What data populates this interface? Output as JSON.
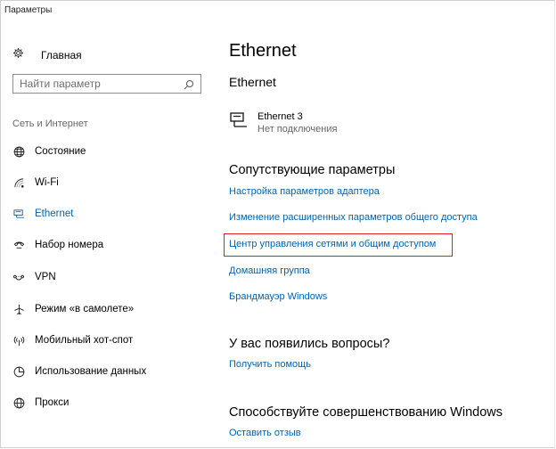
{
  "window": {
    "title": "Параметры"
  },
  "sidebar": {
    "home_label": "Главная",
    "search_placeholder": "Найти параметр",
    "section_title": "Сеть и Интернет",
    "items": [
      {
        "label": "Состояние",
        "icon": "globe-icon"
      },
      {
        "label": "Wi-Fi",
        "icon": "wifi-icon"
      },
      {
        "label": "Ethernet",
        "icon": "ethernet-icon",
        "active": true
      },
      {
        "label": "Набор номера",
        "icon": "dialup-icon"
      },
      {
        "label": "VPN",
        "icon": "vpn-icon"
      },
      {
        "label": "Режим «в самолете»",
        "icon": "airplane-icon"
      },
      {
        "label": "Мобильный хот-спот",
        "icon": "hotspot-icon"
      },
      {
        "label": "Использование данных",
        "icon": "data-usage-icon"
      },
      {
        "label": "Прокси",
        "icon": "proxy-icon"
      }
    ]
  },
  "main": {
    "title": "Ethernet",
    "subtitle": "Ethernet",
    "network": {
      "name": "Ethernet 3",
      "status": "Нет подключения"
    },
    "related_title": "Сопутствующие параметры",
    "related_links": [
      "Настройка параметров адаптера",
      "Изменение расширенных параметров общего доступа",
      "Центр управления сетями и общим доступом",
      "Домашняя группа",
      "Брандмауэр Windows"
    ],
    "questions_title": "У вас появились вопросы?",
    "help_link": "Получить помощь",
    "improve_title": "Способствуйте совершенствованию Windows",
    "feedback_link": "Оставить отзыв"
  },
  "colors": {
    "accent": "#0063b1",
    "highlight": "#e02020",
    "muted": "#666666"
  }
}
